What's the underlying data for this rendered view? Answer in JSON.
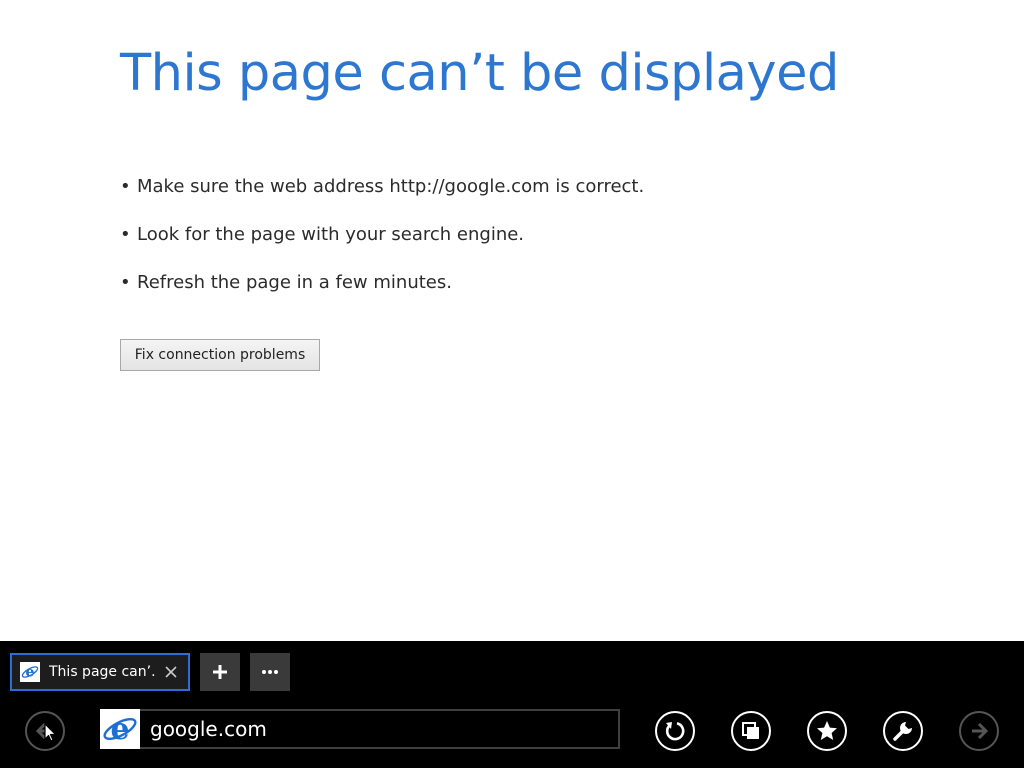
{
  "error": {
    "title": "This page can’t be displayed",
    "suggestions": [
      "Make sure the web address http://google.com is correct.",
      "Look for the page with your search engine.",
      "Refresh the page in a few minutes."
    ],
    "fix_button_label": "Fix connection problems"
  },
  "tabs": [
    {
      "label": "This page can’...",
      "icon": "ie-icon",
      "active": true
    }
  ],
  "tab_bar": {
    "new_tab_icon": "plus-icon",
    "tab_tools_icon": "ellipsis-icon"
  },
  "nav": {
    "back_icon": "back-arrow-icon",
    "address_value": "google.com",
    "address_icon": "ie-icon",
    "refresh_icon": "refresh-icon",
    "pin_icon": "pin-icon",
    "favorite_icon": "star-icon",
    "page_tools_icon": "wrench-icon",
    "forward_icon": "forward-arrow-icon"
  },
  "colors": {
    "title": "#2e77d0",
    "appbar": "#000000",
    "tab_border": "#2d6dd6",
    "ie_blue": "#1e6fd0"
  }
}
